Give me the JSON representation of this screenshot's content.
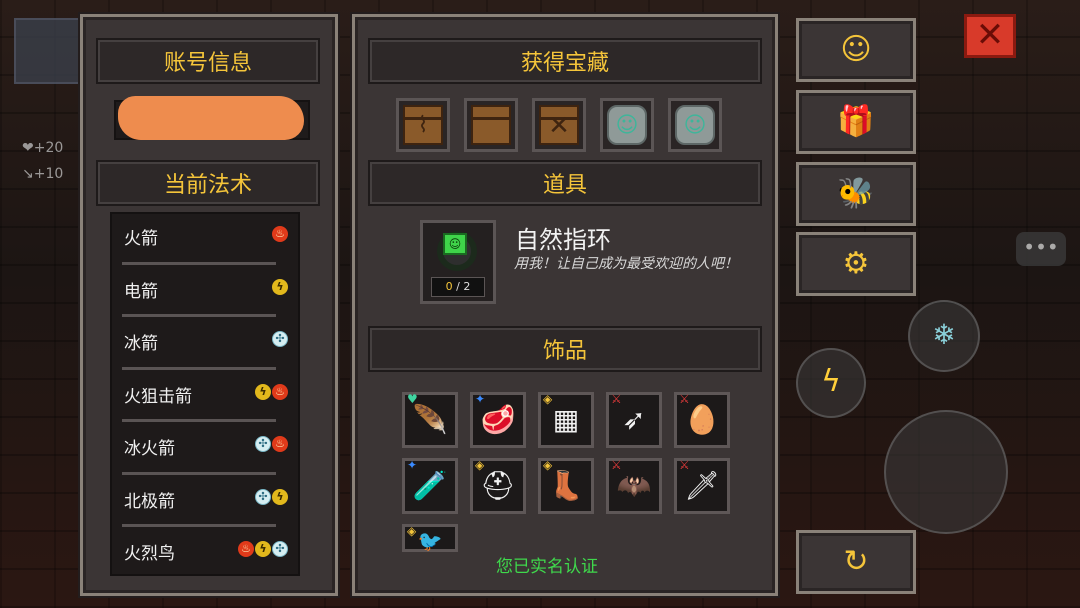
{
  "account_panel": {
    "title": "账号信息",
    "spells_title": "当前法术",
    "spells": [
      {
        "name": "火箭",
        "elements": [
          "fire"
        ]
      },
      {
        "name": "电箭",
        "elements": [
          "thunder"
        ]
      },
      {
        "name": "冰箭",
        "elements": [
          "ice"
        ]
      },
      {
        "name": "火狙击箭",
        "elements": [
          "thunder",
          "fire"
        ]
      },
      {
        "name": "冰火箭",
        "elements": [
          "ice",
          "fire"
        ]
      },
      {
        "name": "北极箭",
        "elements": [
          "ice",
          "thunder"
        ]
      },
      {
        "name": "火烈鸟",
        "elements": [
          "fire",
          "thunder",
          "ice"
        ]
      }
    ]
  },
  "treasure_panel": {
    "title": "获得宝藏",
    "treasures": [
      "chest-map",
      "chest-plain",
      "chest-x",
      "stone-tablet",
      "stone-tablet"
    ],
    "item_section_title": "道具",
    "item": {
      "name": "自然指环",
      "description": "用我！让自己成为最受欢迎的人吧！",
      "count_current": "0",
      "count_total": "/ 2"
    },
    "accessories_title": "饰品",
    "accessories": [
      {
        "icon": "feather-icon",
        "glyph": "🪶",
        "badge": "♥",
        "badge_color": "#3fd4a0"
      },
      {
        "icon": "meat-icon",
        "glyph": "🥩",
        "badge": "✦",
        "badge_color": "#3a8aff"
      },
      {
        "icon": "chip-icon",
        "glyph": "▦",
        "badge": "◈",
        "badge_color": "#f5c53a"
      },
      {
        "icon": "dagger-icon",
        "glyph": "➶",
        "badge": "⚔",
        "badge_color": "#e03a3a"
      },
      {
        "icon": "egg-icon",
        "glyph": "🥚",
        "badge": "⚔",
        "badge_color": "#e03a3a"
      },
      {
        "icon": "bottle-icon",
        "glyph": "🧪",
        "badge": "✦",
        "badge_color": "#3a8aff"
      },
      {
        "icon": "helmet-icon",
        "glyph": "⛑",
        "badge": "◈",
        "badge_color": "#f5c53a"
      },
      {
        "icon": "boot-icon",
        "glyph": "👢",
        "badge": "◈",
        "badge_color": "#f5c53a"
      },
      {
        "icon": "cloak-icon",
        "glyph": "🦇",
        "badge": "⚔",
        "badge_color": "#e03a3a"
      },
      {
        "icon": "claw-icon",
        "glyph": "🗡",
        "badge": "⚔",
        "badge_color": "#e03a3a"
      },
      {
        "icon": "bird-icon",
        "glyph": "🐦",
        "badge": "◈",
        "badge_color": "#f5c53a"
      }
    ],
    "realname_status": "您已实名认证"
  },
  "side_buttons": [
    {
      "name": "customer-service-button",
      "icon": "headset-icon",
      "glyph": "☺"
    },
    {
      "name": "gift-button",
      "icon": "gift-icon",
      "glyph": "🎁"
    },
    {
      "name": "bee-button",
      "icon": "bee-icon",
      "glyph": "🐝"
    },
    {
      "name": "settings-button",
      "icon": "gear-icon",
      "glyph": "⚙"
    },
    {
      "name": "refresh-button",
      "icon": "refresh-icon",
      "glyph": "↻"
    }
  ],
  "background_hud": {
    "stat_1": "+20",
    "stat_2": "+10"
  }
}
